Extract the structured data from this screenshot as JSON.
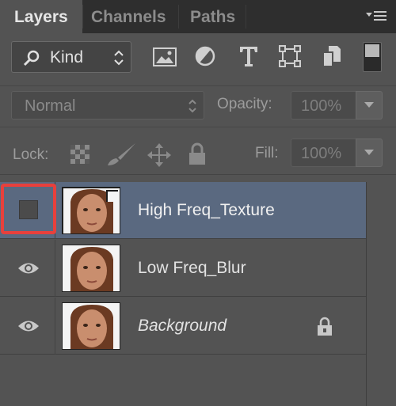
{
  "tabs": [
    {
      "label": "Layers",
      "active": true
    },
    {
      "label": "Channels",
      "active": false
    },
    {
      "label": "Paths",
      "active": false
    }
  ],
  "filter": {
    "kind_label": "Kind",
    "icons": [
      "pixel-layer-filter-icon",
      "adjustment-layer-filter-icon",
      "type-layer-filter-icon",
      "shape-layer-filter-icon",
      "smart-object-filter-icon"
    ]
  },
  "blend": {
    "mode": "Normal",
    "opacity_label": "Opacity:",
    "opacity_value": "100%"
  },
  "lock": {
    "label": "Lock:",
    "fill_label": "Fill:",
    "fill_value": "100%"
  },
  "layers": [
    {
      "name": "High Freq_Texture",
      "visible": false,
      "selected": true,
      "locked": false,
      "italic": false
    },
    {
      "name": "Low Freq_Blur",
      "visible": true,
      "selected": false,
      "locked": false,
      "italic": false
    },
    {
      "name": "Background",
      "visible": true,
      "selected": false,
      "locked": true,
      "italic": true
    }
  ],
  "colors": {
    "panel_bg": "#535353",
    "selected_row": "#5a6980",
    "highlight": "#e8403c"
  }
}
